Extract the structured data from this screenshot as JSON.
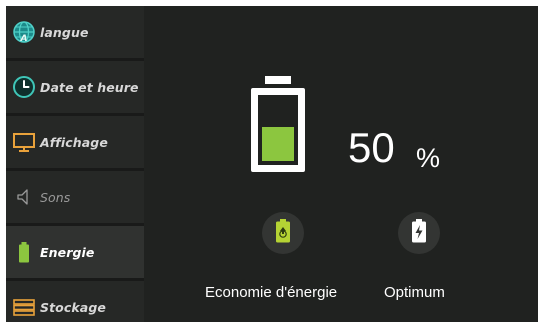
{
  "sidebar": {
    "items": [
      {
        "label": "langue",
        "icon": "globe-icon"
      },
      {
        "label": "Date et heure",
        "icon": "clock-icon"
      },
      {
        "label": "Affichage",
        "icon": "monitor-icon"
      },
      {
        "label": "Sons",
        "icon": "speaker-icon"
      },
      {
        "label": "Energie",
        "icon": "battery-icon"
      },
      {
        "label": "Stockage",
        "icon": "storage-icon"
      }
    ],
    "active": "Energie"
  },
  "battery": {
    "level_percent": 50,
    "value": "50",
    "unit": "%"
  },
  "modes": [
    {
      "label": "Economie d'énergie",
      "icon": "eco-battery-icon"
    },
    {
      "label": "Optimum",
      "icon": "charging-battery-icon"
    }
  ],
  "colors": {
    "accent": "#8cc63f",
    "background": "#202220",
    "sidebar_item": "#262826",
    "text": "#ffffff"
  }
}
